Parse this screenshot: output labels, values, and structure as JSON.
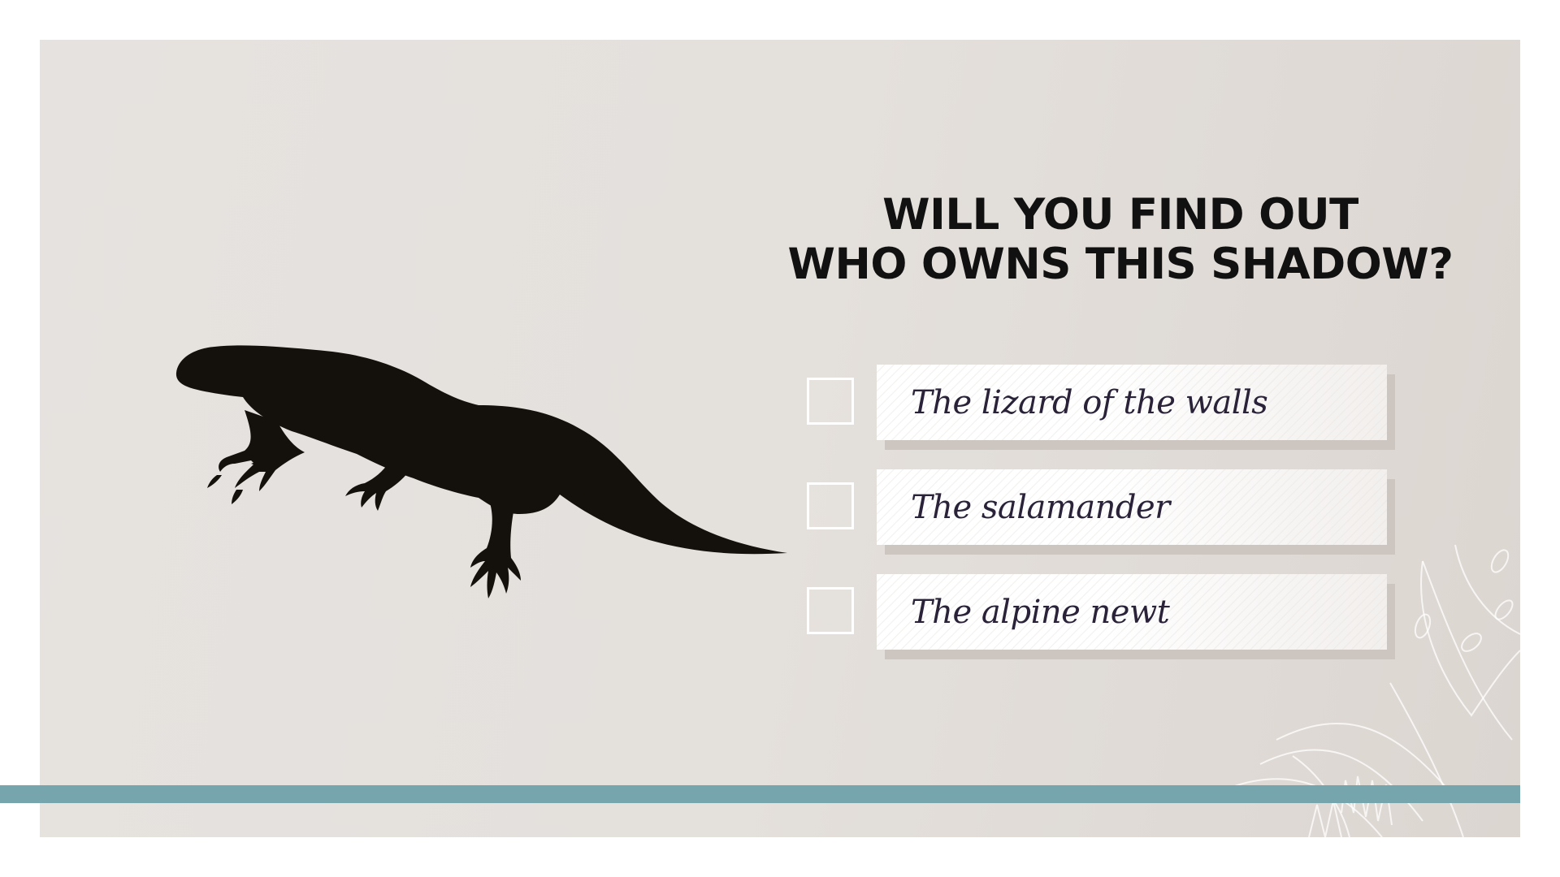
{
  "quiz": {
    "title_line1": "WILL YOU FIND OUT",
    "title_line2": "WHO OWNS THIS SHADOW?",
    "image_icon": "newt-silhouette",
    "options": [
      {
        "label": "The lizard of the walls",
        "checked": false
      },
      {
        "label": "The salamander",
        "checked": false
      },
      {
        "label": "The alpine newt",
        "checked": false
      }
    ]
  },
  "colors": {
    "panel_background": "#e4e0dc",
    "accent_bar": "#76a5ad",
    "silhouette": "#14110d",
    "title_text": "#111111",
    "option_text": "#2a2238",
    "checkbox_border": "#ffffff"
  }
}
